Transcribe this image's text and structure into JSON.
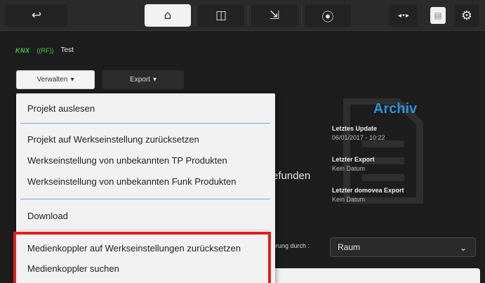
{
  "toolbar": {
    "back_icon": "↩",
    "home_icon": "⌂",
    "cube_icon": "◫",
    "import_icon": "⇲",
    "location_icon": "⦿",
    "connect_icon": "◂•▸",
    "document_icon": "▤",
    "settings_icon": "⚙"
  },
  "status": {
    "knx": "KNX",
    "rf": "((RF))",
    "project": "Test"
  },
  "buttons": {
    "verwalten": "Verwalten",
    "export": "Export",
    "caret": "▾"
  },
  "menu": {
    "items": [
      "Projekt auslesen",
      "Projekt auf Werkseinstellung zurücksetzen",
      "Werkseinstellung von unbekannten TP Produkten",
      "Werkseinstellung von unbekannten Funk Produkten",
      "Download",
      "Medienkoppler auf Werkseinstellungen zurücksetzen",
      "Medienkoppler suchen"
    ]
  },
  "archive": {
    "title": "Archiv",
    "last_update_label": "Letztes Update",
    "last_update_value": "06/01/2017 - 10:22",
    "last_export_label": "Letzter Export",
    "last_export_value": "Kein Datum",
    "last_domovea_label": "Letzter domovea Export",
    "last_domovea_value": "Kein Datum"
  },
  "main": {
    "found_text": "efunden",
    "filter_label": "erung durch :",
    "filter_value": "Raum",
    "filter_chevron": "⌄"
  },
  "colors": {
    "accent": "#2e8fd6",
    "knx_green": "#4bc94b",
    "highlight_red": "#e41e1e"
  }
}
